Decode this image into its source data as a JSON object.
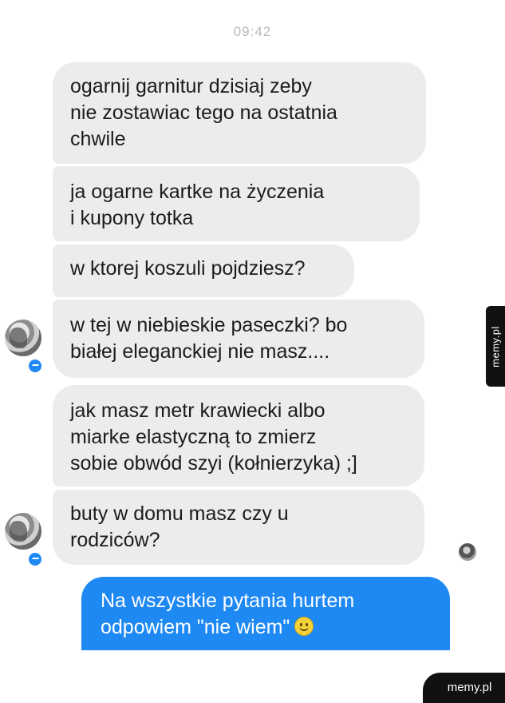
{
  "chat": {
    "timestamp": "09:42",
    "incoming_messages": [
      "ogarnij garnitur dzisiaj zeby\nnie zostawiac tego na ostatnia\nchwile",
      "ja ogarne kartke na życzenia\ni kupony totka",
      "w ktorej koszuli pojdziesz?",
      "w tej w niebieskie paseczki? bo\nbiałej eleganckiej nie masz....",
      "jak masz metr krawiecki albo\nmiarke elastyczną to zmierz\nsobie obwód szyi (kołnierzyka) ;]",
      "buty w domu masz czy u\nrodziców?"
    ],
    "outgoing_message": "Na wszystkie pytania hurtem\nodpowiem \"nie wiem\"",
    "outgoing_emoji": "smiley-emoji"
  },
  "watermarks": {
    "side": "memy.pl",
    "corner": "memy.pl"
  },
  "colors": {
    "incoming_bubble": "#ececee",
    "outgoing_bubble": "#1e88f3",
    "timestamp": "#b9b9b9",
    "watermark_bg": "#111111"
  }
}
